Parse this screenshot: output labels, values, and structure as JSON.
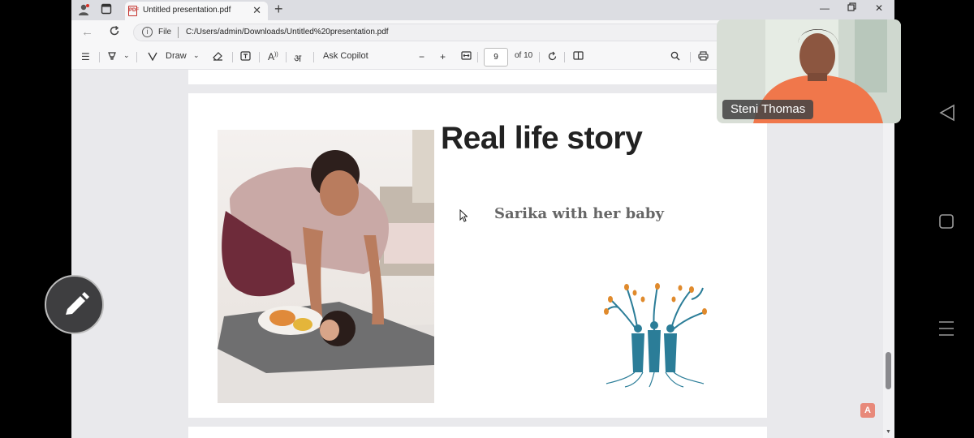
{
  "browser": {
    "tab": {
      "title": "Untitled presentation.pdf"
    },
    "address": {
      "file_label": "File",
      "path": "C:/Users/admin/Downloads/Untitled%20presentation.pdf"
    }
  },
  "pdf_toolbar": {
    "draw_label": "Draw",
    "copilot_label": "Ask Copilot",
    "page_number": "9",
    "page_total": "of 10"
  },
  "slide": {
    "title": "Real life story",
    "subtitle": "Sarika with her baby"
  },
  "video": {
    "participant_name": "Steni Thomas"
  },
  "icons": {
    "brand_pdf_color": "#c4302b",
    "logo_teal": "#2b7d98",
    "logo_orange": "#e08a2c"
  }
}
